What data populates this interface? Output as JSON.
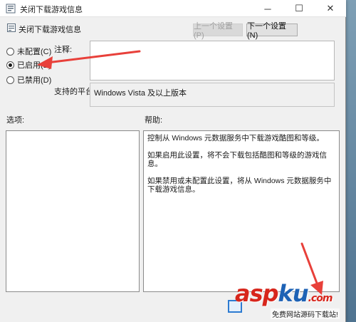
{
  "window": {
    "title": "关闭下载游戏信息",
    "minimize_glyph": "─",
    "maximize_glyph": "☐",
    "close_glyph": "✕"
  },
  "header": {
    "policy_name": "关闭下载游戏信息",
    "prev_label": "上一个设置(P)",
    "next_label": "下一个设置(N)"
  },
  "state": {
    "options": [
      {
        "label": "未配置(C)",
        "checked": false
      },
      {
        "label": "已启用(E)",
        "checked": true
      },
      {
        "label": "已禁用(D)",
        "checked": false
      }
    ]
  },
  "comment": {
    "label": "注释:",
    "value": ""
  },
  "platform": {
    "label": "支持的平台:",
    "value": "Windows Vista 及以上版本"
  },
  "panes": {
    "options_label": "选项:",
    "help_label": "帮助:",
    "help_paragraphs": [
      "控制从 Windows 元数据服务中下载游戏酷图和等级。",
      "如果启用此设置，将不会下载包括酷图和等级的游戏信息。",
      "如果禁用或未配置此设置，将从 Windows 元数据服务中下载游戏信息。"
    ]
  },
  "watermark": {
    "brand_a": "asp",
    "brand_b": "ku",
    "brand_c": ".com",
    "caption": "免费网站源码下载站!"
  },
  "colors": {
    "arrow": "#e8403a",
    "focus_button_border": "#2d7bd1"
  }
}
